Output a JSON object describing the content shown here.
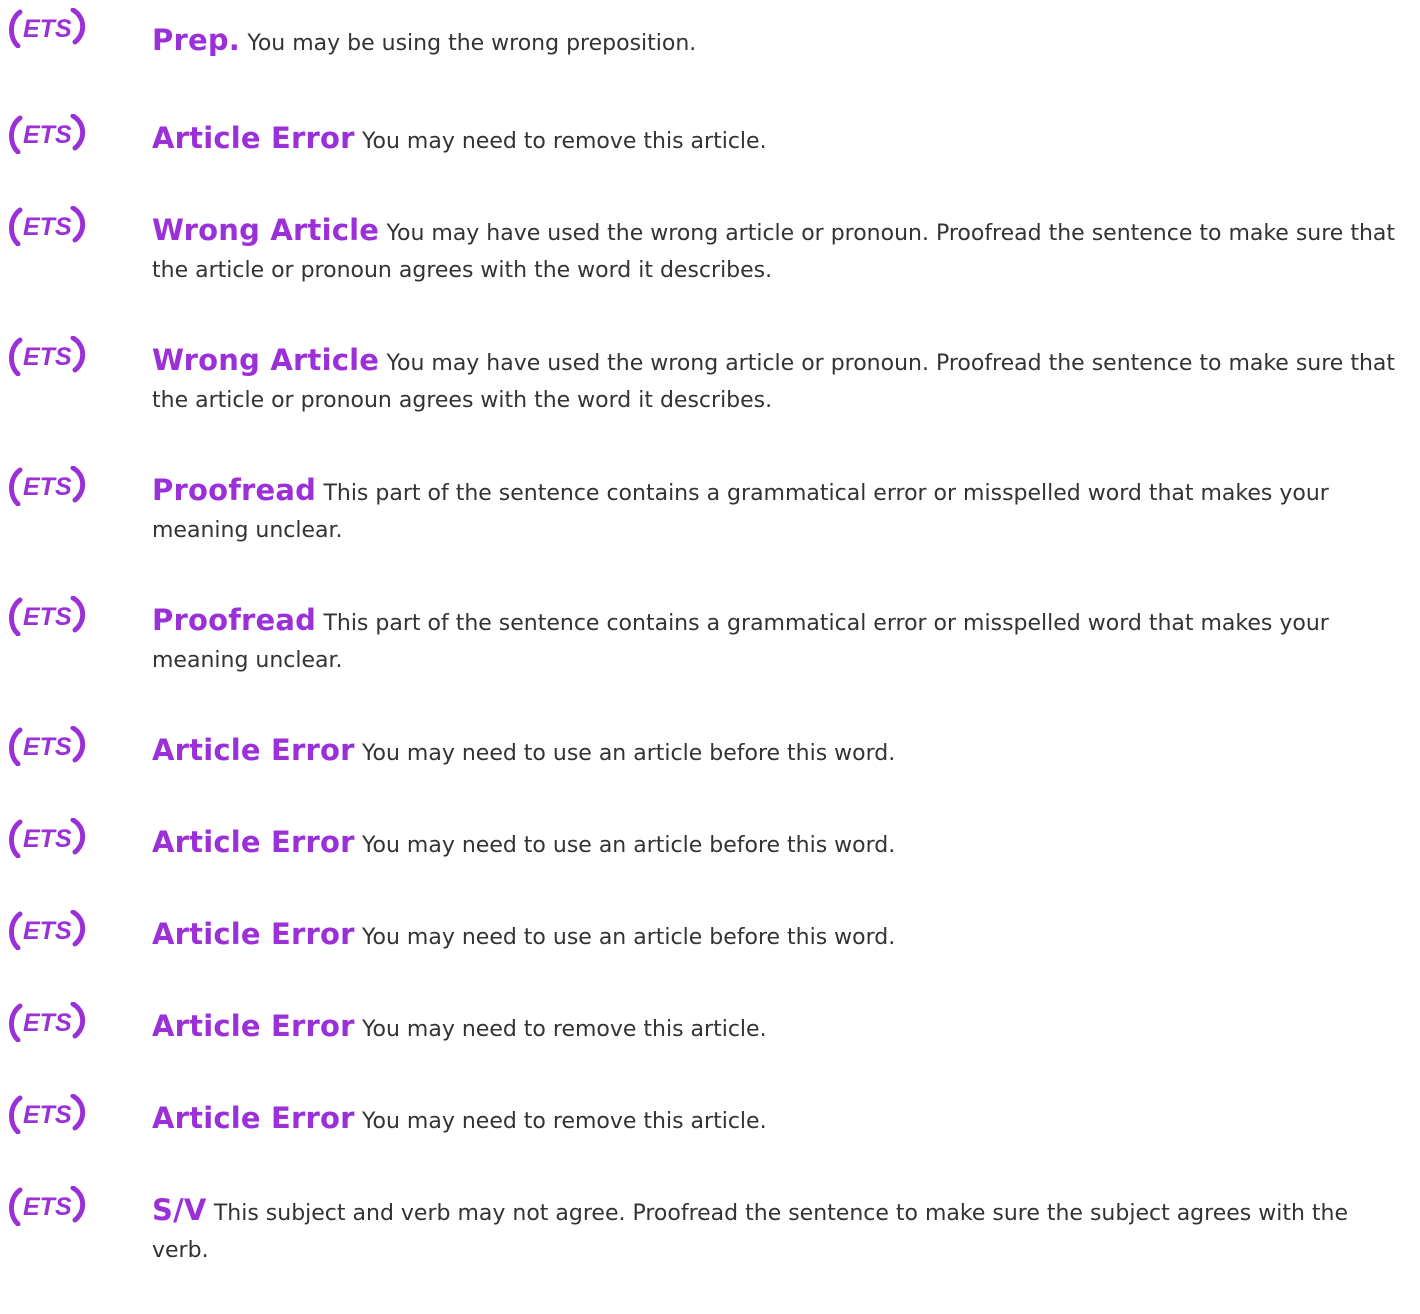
{
  "brand": {
    "logo_text": "ETS",
    "accent_color": "#9b30d9",
    "text_color": "#333333"
  },
  "items": [
    {
      "category": "Prep.",
      "message": "You may be using the wrong preposition."
    },
    {
      "category": "Article Error",
      "message": "You may need to remove this article."
    },
    {
      "category": "Wrong Article",
      "message": "You may have used the wrong article or pronoun. Proofread the sentence to make sure that the article or pronoun agrees with the word it describes."
    },
    {
      "category": "Wrong Article",
      "message": "You may have used the wrong article or pronoun. Proofread the sentence to make sure that the article or pronoun agrees with the word it describes."
    },
    {
      "category": "Proofread",
      "message": "This part of the sentence contains a grammatical error or misspelled word that makes your meaning unclear."
    },
    {
      "category": "Proofread",
      "message": "This part of the sentence contains a grammatical error or misspelled word that makes your meaning unclear."
    },
    {
      "category": "Article Error",
      "message": "You may need to use an article before this word."
    },
    {
      "category": "Article Error",
      "message": "You may need to use an article before this word."
    },
    {
      "category": "Article Error",
      "message": "You may need to use an article before this word."
    },
    {
      "category": "Article Error",
      "message": "You may need to remove this article."
    },
    {
      "category": "Article Error",
      "message": "You may need to remove this article."
    },
    {
      "category": "S/V",
      "message": "This subject and verb may not agree. Proofread the sentence to make sure the subject agrees with the verb."
    }
  ]
}
